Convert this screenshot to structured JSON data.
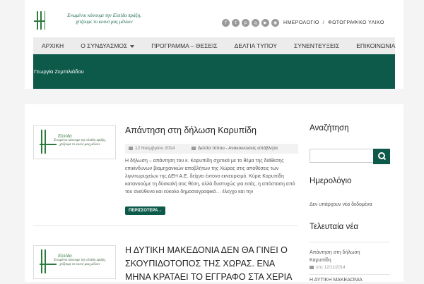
{
  "header": {
    "logo_text_line1": "Ενωμένοι κάνουμε την Ελπίδα πράξη,",
    "logo_text_line2": "χτίζουμε το κοινό μας μέλλον",
    "social_icons": [
      "facebook-icon",
      "twitter-icon",
      "pinterest-icon",
      "google-plus-icon",
      "youtube-icon",
      "rss-icon"
    ],
    "links": [
      "ΗΜΕΡΟΛΟΓΙΟ",
      "ΦΩΤΟΓΡΑΦΙΚΟ ΥΛΙΚΟ"
    ],
    "separator": "/"
  },
  "nav": {
    "items": [
      "ΑΡΧΙΚΗ",
      "Ο ΣΥΝΔΥΑΣΜΟΣ",
      "ΠΡΟΓΡΑΜΜΑ – ΘΕΣΕΙΣ",
      "ΔΕΛΤΙΑ ΤΥΠΟΥ",
      "ΣΥΝΕΝΤΕΥΞΕΙΣ",
      "ΕΠΙΚΟΙΝΩΝΙΑ"
    ]
  },
  "breadcrumb": "Γεωργία Ζεμπιλιάδου",
  "colors": {
    "accent": "#0d5a4b",
    "nav_bg": "#ececec"
  },
  "posts": [
    {
      "thumb_brand": "Ελπίδα",
      "thumb_tagline": "Ενωμένοι κάνουμε την ελπίδα πράξη, χτίζουμε το κοινό μας μέλλον",
      "title": "Απάντηση στη δήλωση Καρυπίδη",
      "date": "12 Νοεμβρίου 2014",
      "category": "Δελτία τύπου - Ανακοινώσεις απόβλητα",
      "excerpt": "Η δήλωση – απάντηση του κ. Καρυπίδη σχετικά με το θέμα της διάθεσης επικίνδυνων βιομηχανικών αποβλήτων της Χώρας στις αποθέσεις των λιγνιτωρυχείων της ΔΕΗ Α.Ε. δείχνει έντονο εκνευρισμό. Κύριε Καρυπίδη κατανοούμε τη δύσκολή σας θέση, αλλά δυστυχώς για εσάς, η απόσταση από του ανεύθυνο και εύκολο δημοσιογραφικό… έλεγχο και την",
      "more": "ΠΕΡΙΣΣΟΤΕΡΑ→"
    },
    {
      "thumb_brand": "Ελπίδα",
      "thumb_tagline": "Ενωμένοι κάνουμε την ελπίδα πράξη, χτίζουμε το κοινό μας μέλλον",
      "title": "Η ΔΥΤΙΚΗ ΜΑΚΕΔΟΝΙΑ ΔΕΝ ΘΑ ΓΙΝΕΙ Ο ΣΚΟΥΠΙΔΟΤΟΠΟΣ ΤΗΣ ΧΩΡΑΣ. ΕΝΑ ΜΗΝΑ ΚΡΑΤΑΕΙ ΤΟ ΕΓΓΡΑΦΟ ΣΤΑ ΧΕΡΙΑ"
    }
  ],
  "sidebar": {
    "search_heading": "Αναζήτηση",
    "calendar_heading": "Ημερολόγιο",
    "calendar_empty": "Δεν υπάρχουν νέα δεδομένα",
    "latest_heading": "Τελευταία νέα",
    "latest": [
      {
        "title_line1": "Απάντηση στη δήλωση",
        "title_line2": "Καρυπίδη",
        "date": "στις 12/11/2014"
      },
      {
        "title_line1": "Η ΔΥΤΙΚΗ ΜΑΚΕΔΟΝΙΑ"
      }
    ]
  }
}
